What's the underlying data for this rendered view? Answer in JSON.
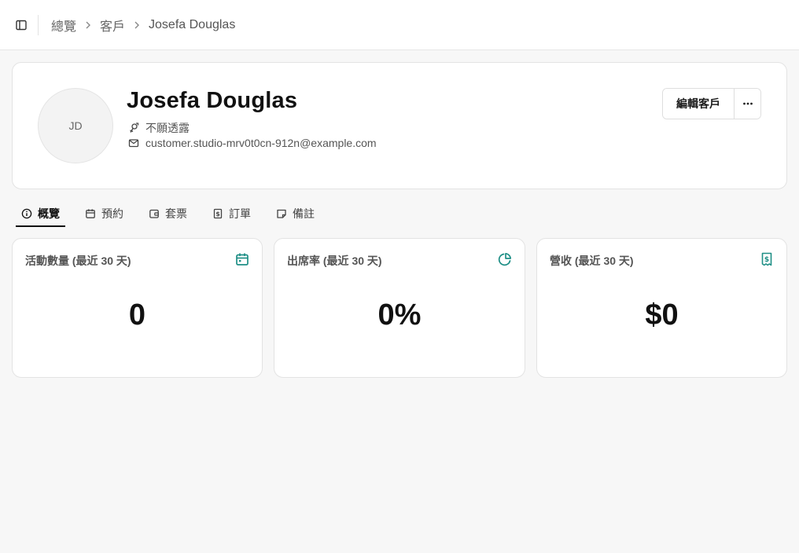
{
  "breadcrumb": {
    "items": [
      "總覽",
      "客戶"
    ],
    "current": "Josefa Douglas"
  },
  "customer": {
    "initials": "JD",
    "name": "Josefa Douglas",
    "gender": "不願透露",
    "email": "customer.studio-mrv0t0cn-912n@example.com"
  },
  "actions": {
    "edit_label": "編輯客戶",
    "more_label": "···"
  },
  "tabs": [
    {
      "label": "概覽",
      "icon": "info-icon",
      "active": true
    },
    {
      "label": "預約",
      "icon": "calendar-icon",
      "active": false
    },
    {
      "label": "套票",
      "icon": "wallet-icon",
      "active": false
    },
    {
      "label": "訂單",
      "icon": "receipt-icon",
      "active": false
    },
    {
      "label": "備註",
      "icon": "sticky-note-icon",
      "active": false
    }
  ],
  "stats": [
    {
      "label": "活動數量 (最近 30 天)",
      "value": "0",
      "icon": "calendar-icon"
    },
    {
      "label": "出席率 (最近 30 天)",
      "value": "0%",
      "icon": "pie-chart-icon"
    },
    {
      "label": "營收 (最近 30 天)",
      "value": "$0",
      "icon": "receipt-icon"
    }
  ],
  "colors": {
    "accent": "#1f8f86",
    "text": "#111111",
    "muted": "#555555",
    "border": "#e3e3e3"
  }
}
